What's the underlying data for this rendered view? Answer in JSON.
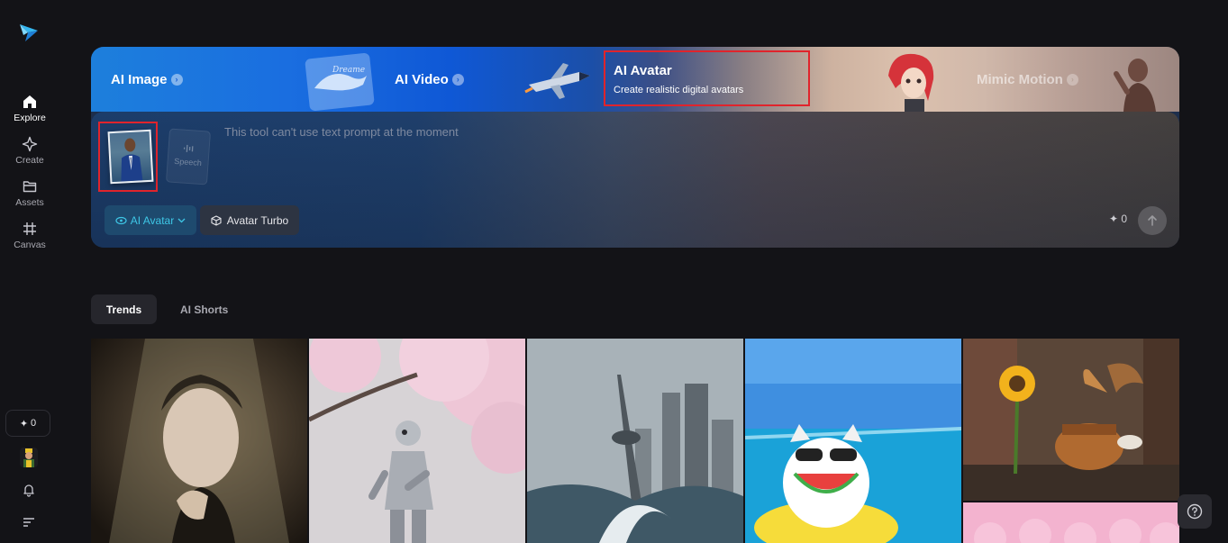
{
  "sidebar": {
    "nav": [
      {
        "label": "Explore",
        "icon": "home-icon"
      },
      {
        "label": "Create",
        "icon": "sparkle-icon"
      },
      {
        "label": "Assets",
        "icon": "folder-icon"
      },
      {
        "label": "Canvas",
        "icon": "hash-frame-icon"
      }
    ],
    "credits": "0"
  },
  "hero": {
    "tabs": [
      {
        "label": "AI Image"
      },
      {
        "label": "AI Video"
      },
      {
        "label": "Mimic Motion"
      }
    ],
    "active_tab": {
      "title": "AI Avatar",
      "subtitle": "Create realistic digital avatars"
    },
    "speech_label": "Speech",
    "prompt_placeholder": "This tool can't use text prompt at the moment",
    "model_select": "AI Avatar",
    "turbo_button": "Avatar Turbo",
    "cost": "0"
  },
  "feed": {
    "tabs": [
      "Trends",
      "AI Shorts"
    ]
  },
  "colors": {
    "accent": "#3ec7e6",
    "highlight_border": "#e0242c",
    "background": "#131317"
  }
}
